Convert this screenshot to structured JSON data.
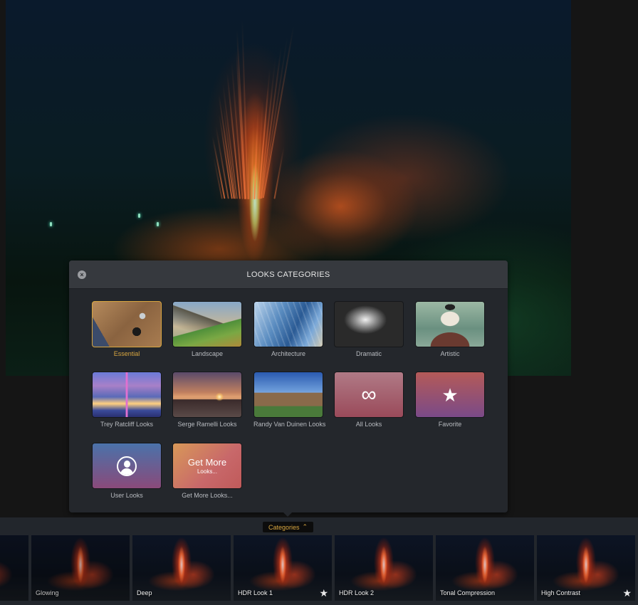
{
  "photo": {
    "subject": "volcano-eruption-night"
  },
  "panel": {
    "title": "LOOKS CATEGORIES",
    "close_label": "×",
    "categories": [
      {
        "label": "Essential",
        "thumb": "essential",
        "selected": true
      },
      {
        "label": "Landscape",
        "thumb": "landscape"
      },
      {
        "label": "Architecture",
        "thumb": "architecture"
      },
      {
        "label": "Dramatic",
        "thumb": "dramatic"
      },
      {
        "label": "Artistic",
        "thumb": "artistic"
      },
      {
        "label": "Trey Ratcliff Looks",
        "thumb": "trey"
      },
      {
        "label": "Serge Ramelli Looks",
        "thumb": "serge"
      },
      {
        "label": "Randy Van Duinen Looks",
        "thumb": "randy"
      },
      {
        "label": "All Looks",
        "thumb": "all",
        "icon": "infinity-icon",
        "glyph": "∞"
      },
      {
        "label": "Favorite",
        "thumb": "fav",
        "icon": "star-icon",
        "glyph": "★"
      },
      {
        "label": "User Looks",
        "thumb": "user",
        "icon": "user-icon"
      },
      {
        "label": "Get More Looks...",
        "thumb": "more",
        "big_text": "Get More",
        "small_text": "Looks..."
      }
    ]
  },
  "categories_button": {
    "label": "Categories",
    "chevron": "⌃"
  },
  "looks": [
    {
      "label": "",
      "favorite": false
    },
    {
      "label": "Glowing",
      "favorite": false
    },
    {
      "label": "Deep",
      "favorite": false
    },
    {
      "label": "HDR Look 1",
      "favorite": true
    },
    {
      "label": "HDR Look 2",
      "favorite": false
    },
    {
      "label": "Tonal Compression",
      "favorite": false
    },
    {
      "label": "High Contrast",
      "favorite": true
    }
  ],
  "colors": {
    "accent": "#d8a640",
    "panel_bg": "#24272c",
    "header_bg": "#36393e"
  }
}
